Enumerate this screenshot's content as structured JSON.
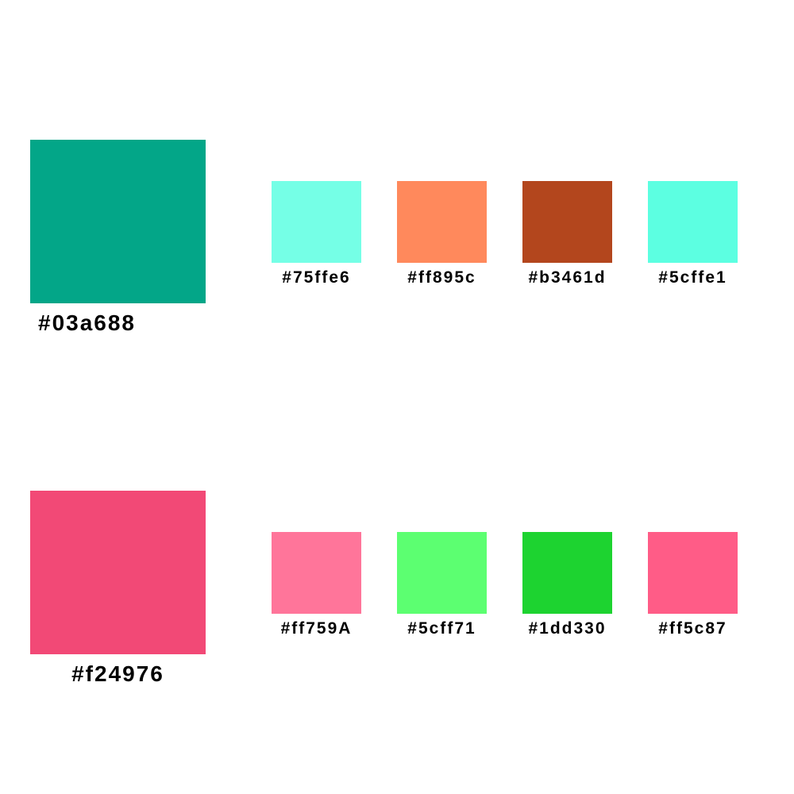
{
  "palettes": [
    {
      "main": {
        "color": "#03a688",
        "label": "#03a688"
      },
      "swatches": [
        {
          "color": "#75ffe6",
          "label": "#75ffe6"
        },
        {
          "color": "#ff895c",
          "label": "#ff895c"
        },
        {
          "color": "#b3461d",
          "label": "#b3461d"
        },
        {
          "color": "#5cffe1",
          "label": "#5cffe1"
        }
      ]
    },
    {
      "main": {
        "color": "#f24976",
        "label": "#f24976"
      },
      "swatches": [
        {
          "color": "#ff759A",
          "label": "#ff759A"
        },
        {
          "color": "#5cff71",
          "label": "#5cff71"
        },
        {
          "color": "#1dd330",
          "label": "#1dd330"
        },
        {
          "color": "#ff5c87",
          "label": "#ff5c87"
        }
      ]
    }
  ]
}
